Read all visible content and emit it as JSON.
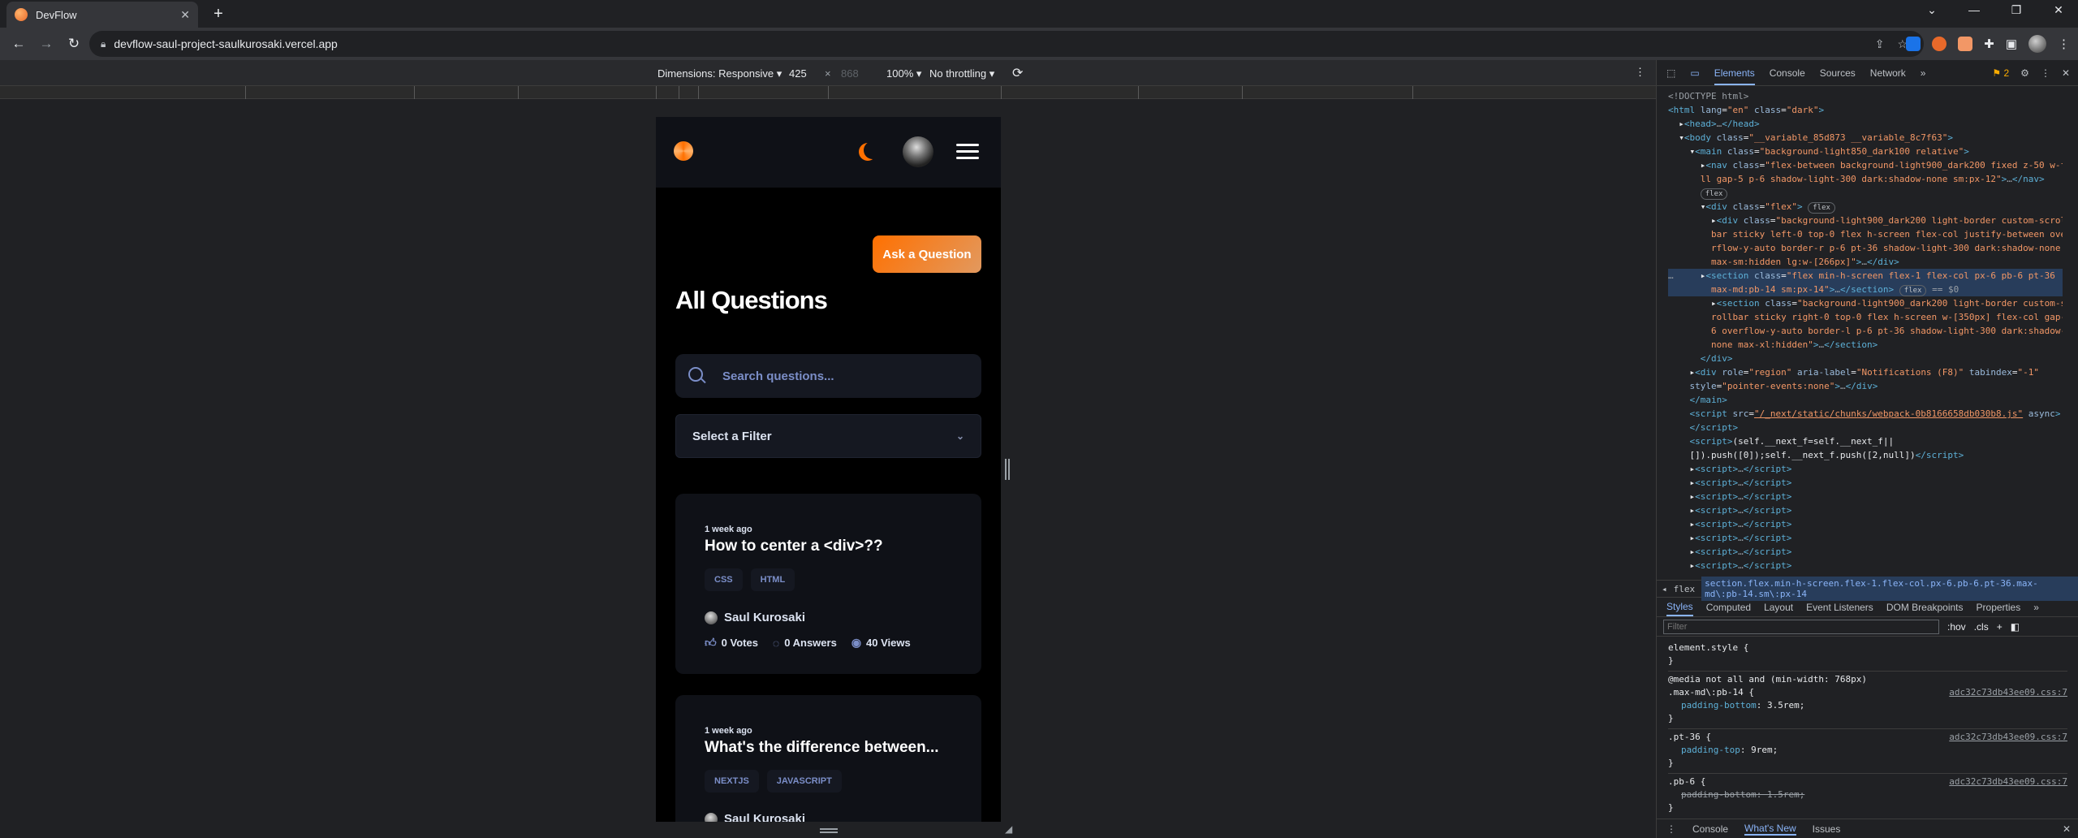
{
  "browser": {
    "tab_title": "DevFlow",
    "url": "devflow-saul-project-saulkurosaki.vercel.app"
  },
  "device_toolbar": {
    "dimensions": "Dimensions: Responsive",
    "width": "425",
    "height": "868",
    "zoom": "100%",
    "throttling": "No throttling"
  },
  "app": {
    "ask_button": "Ask a Question",
    "page_title": "All Questions",
    "search_placeholder": "Search questions...",
    "filter_label": "Select a Filter",
    "questions": [
      {
        "time": "1 week ago",
        "title": "How to center a <div>??",
        "tags": [
          "CSS",
          "HTML"
        ],
        "author": "Saul Kurosaki",
        "votes": "0 Votes",
        "answers": "0 Answers",
        "views": "40 Views"
      },
      {
        "time": "1 week ago",
        "title": "What's the difference between...",
        "tags": [
          "NEXTJS",
          "JAVASCRIPT"
        ],
        "author": "Saul Kurosaki"
      }
    ]
  },
  "devtools": {
    "tabs": [
      "Elements",
      "Console",
      "Sources",
      "Network"
    ],
    "issues_count": "2",
    "breadcrumb_prev": "flex",
    "breadcrumb": "section.flex.min-h-screen.flex-1.flex-col.px-6.pb-6.pt-36.max-md\\:pb-14.sm\\:px-14",
    "styles_tabs": [
      "Styles",
      "Computed",
      "Layout",
      "Event Listeners",
      "DOM Breakpoints",
      "Properties"
    ],
    "filter_placeholder": "Filter",
    "hov": ":hov",
    "cls": ".cls",
    "drawer_tabs": [
      "Console",
      "What's New",
      "Issues"
    ]
  }
}
